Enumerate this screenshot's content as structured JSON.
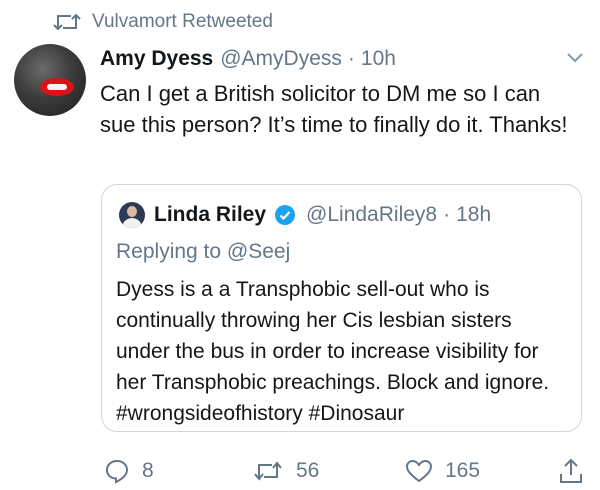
{
  "retweet": {
    "label": "Vulvamort Retweeted"
  },
  "tweet": {
    "name": "Amy Dyess",
    "handle": "@AmyDyess",
    "separator": "·",
    "time": "10h",
    "text": "Can I get a British solicitor to DM me so I can sue this person? It’s time to finally do it. Thanks!"
  },
  "quoted": {
    "name": "Linda Riley",
    "handle": "@LindaRiley8",
    "separator": "·",
    "time": "18h",
    "replying_prefix": "Replying to",
    "replying_to": "@Seej",
    "text": "Dyess is a a Transphobic sell-out who is continually throwing her Cis lesbian sisters under the bus in order to increase visibility for her Transphobic preachings. Block and ignore. #wrongsideofhistory #Dinosaur"
  },
  "actions": {
    "replies": "8",
    "retweets": "56",
    "likes": "165"
  },
  "colors": {
    "text": "#14171a",
    "secondary": "#657786",
    "border": "#ccd6dd",
    "verified": "#1da1f2"
  },
  "icons": [
    "retweet-icon",
    "chevron-down-icon",
    "verified-badge-icon",
    "reply-icon",
    "like-icon",
    "share-icon"
  ]
}
